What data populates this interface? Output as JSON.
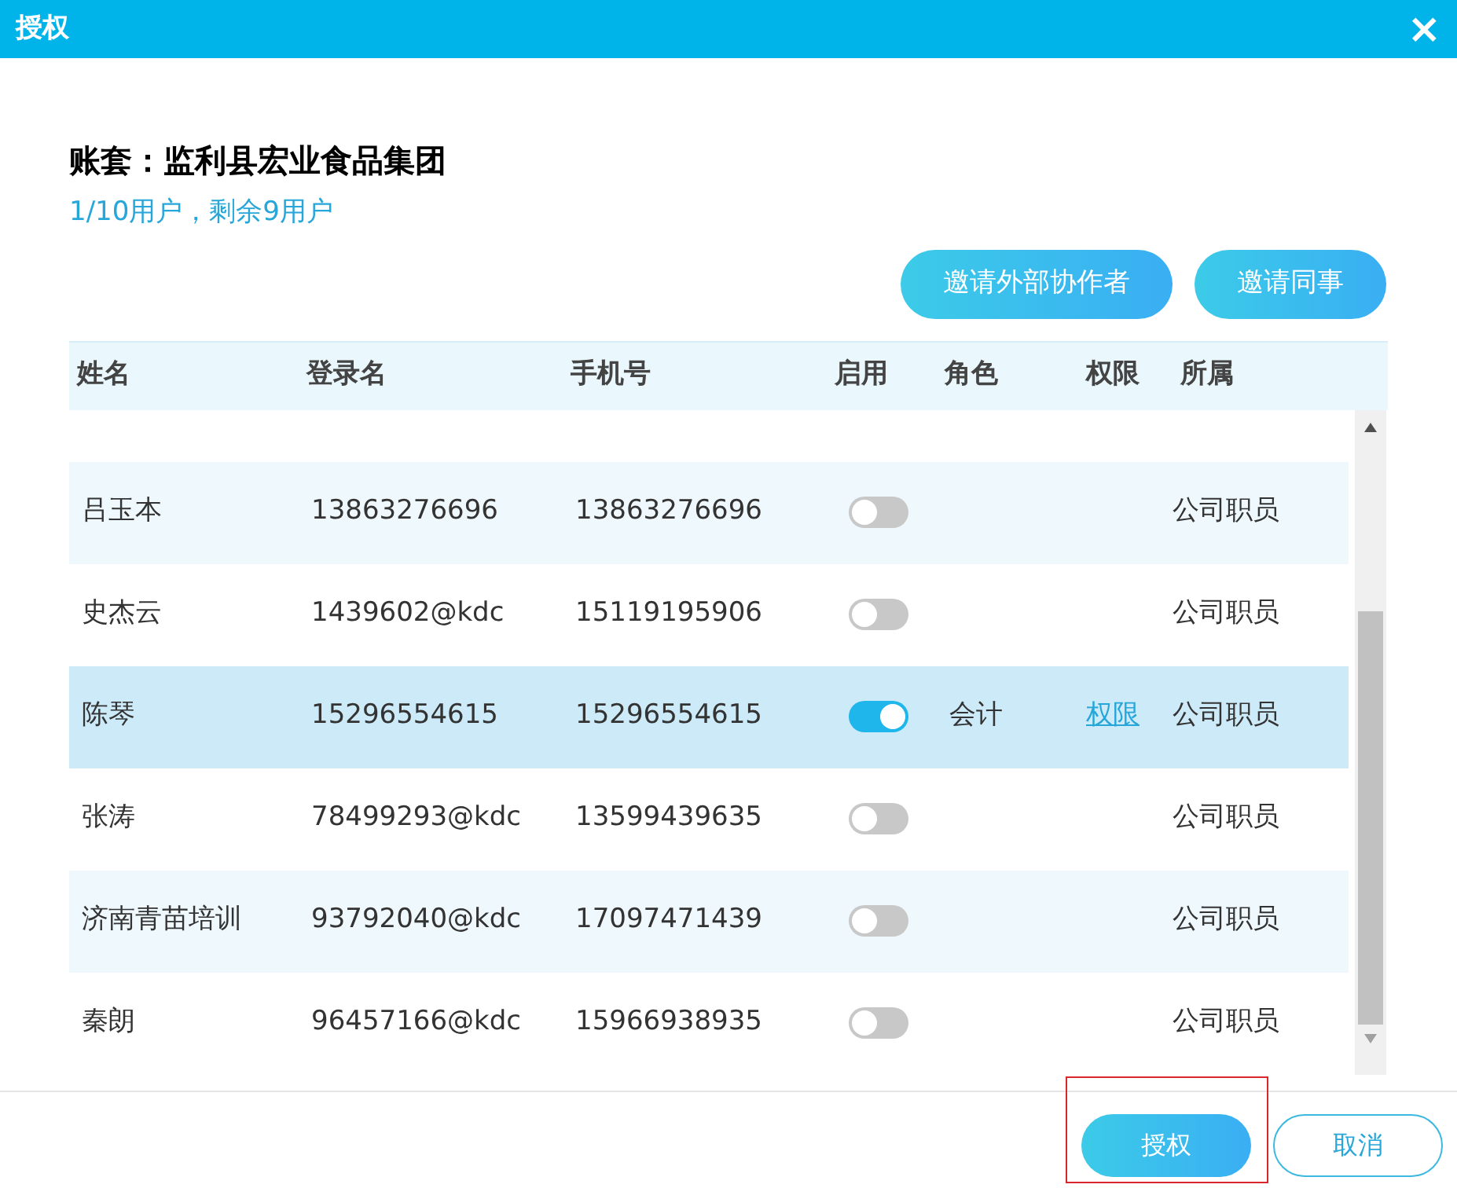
{
  "window": {
    "title": "授权",
    "close": "×"
  },
  "account": {
    "label": "账套：监利县宏业食品集团",
    "usage": "1/10用户，剩余9用户"
  },
  "invite_buttons": [
    "邀请外部协作者",
    "邀请同事"
  ],
  "table": {
    "columns": [
      "姓名",
      "登录名",
      "手机号",
      "启用",
      "角色",
      "权限",
      "所属"
    ],
    "rows": [
      {
        "name": "吕玉本",
        "login": "13863276696",
        "phone": "13863276696",
        "on": false,
        "selected": false,
        "dept": "公司职员"
      },
      {
        "name": "史杰云",
        "login": "1439602@kdc",
        "phone": "15119195906",
        "on": false,
        "selected": false,
        "dept": "公司职员"
      },
      {
        "name": "陈琴",
        "login": "15296554615",
        "phone": "15296554615",
        "on": true,
        "selected": true,
        "role": "会计",
        "permission": "权限",
        "dept": "公司职员"
      },
      {
        "name": "张涛",
        "login": "78499293@kdc",
        "phone": "13599439635",
        "on": false,
        "selected": false,
        "dept": "公司职员"
      },
      {
        "name": "济南青苗培训",
        "login": "93792040@kdc",
        "phone": "17097471439",
        "on": false,
        "selected": false,
        "dept": "公司职员"
      },
      {
        "name": "秦朗",
        "login": "96457166@kdc",
        "phone": "15966938935",
        "on": false,
        "selected": false,
        "dept": "公司职员"
      }
    ]
  },
  "footer": {
    "confirm": {
      "label": "授权",
      "highlighted": true
    },
    "cancel": "取消"
  }
}
